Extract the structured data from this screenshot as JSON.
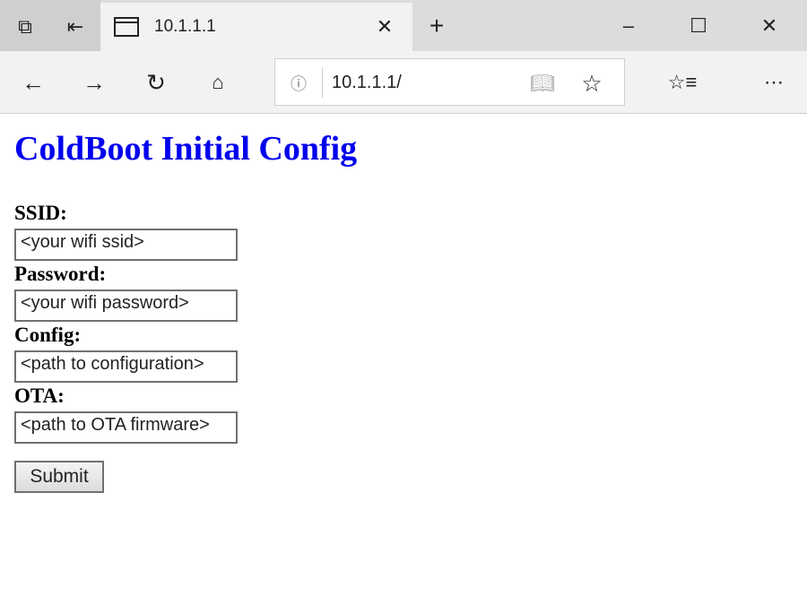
{
  "browser": {
    "tab_title": "10.1.1.1",
    "url": "10.1.1.1/",
    "icons": [
      "tab-preview-icon",
      "set-aside-tabs-icon",
      "page-icon",
      "close-icon",
      "new-tab-icon",
      "minimize-icon",
      "maximize-icon",
      "window-close-icon",
      "back-icon",
      "forward-icon",
      "refresh-icon",
      "home-icon",
      "info-icon",
      "reading-view-icon",
      "favorite-star-icon",
      "favorites-list-icon",
      "more-icon"
    ]
  },
  "page": {
    "heading": "ColdBoot Initial Config",
    "fields": [
      {
        "label": "SSID:",
        "value": "<your wifi ssid>"
      },
      {
        "label": "Password:",
        "value": "<your wifi password>"
      },
      {
        "label": "Config:",
        "value": "<path to configuration>"
      },
      {
        "label": "OTA:",
        "value": "<path to OTA firmware>"
      }
    ],
    "submit_label": "Submit"
  },
  "colors": {
    "heading": "#0000ee"
  }
}
